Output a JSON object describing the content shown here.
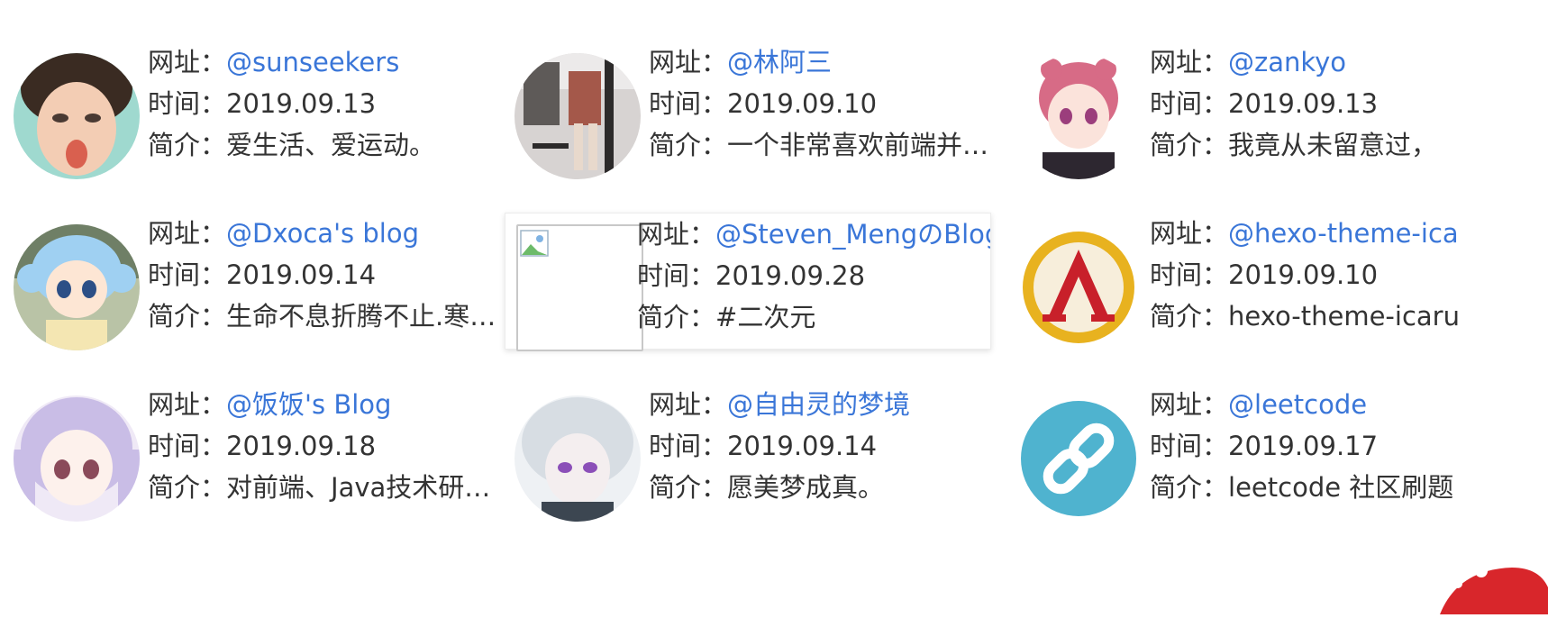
{
  "labels": {
    "url": "网址：",
    "time": "时间：",
    "intro": "简介："
  },
  "links": [
    {
      "name": "@sunseekers",
      "time": "2019.09.13",
      "intro": "爱生活、爱运动。"
    },
    {
      "name": "@林阿三",
      "time": "2019.09.10",
      "intro": "一个非常喜欢前端并…"
    },
    {
      "name": "@zankyo",
      "time": "2019.09.13",
      "intro": "我竟从未留意过，"
    },
    {
      "name": "@Dxoca's blog",
      "time": "2019.09.14",
      "intro": "生命不息折腾不止.寒…"
    },
    {
      "name": "@Steven_MengのBlog",
      "time": "2019.09.28",
      "intro": "#二次元"
    },
    {
      "name": "@hexo-theme-ica",
      "time": "2019.09.10",
      "intro": "hexo-theme-icaru"
    },
    {
      "name": "@饭饭's Blog",
      "time": "2019.09.18",
      "intro": "对前端、Java技术研…"
    },
    {
      "name": "@自由灵的梦境",
      "time": "2019.09.14",
      "intro": "愿美梦成真。"
    },
    {
      "name": "@leetcode",
      "time": "2019.09.17",
      "intro": "leetcode 社区刷题"
    }
  ],
  "colors": {
    "link": "#3a76d8",
    "text": "#333333",
    "leetcode_bg": "#4fb3cf",
    "icarus_ring": "#e8b21f",
    "icarus_symbol": "#c8202a"
  },
  "icons": [
    "avatar-sunseekers",
    "avatar-linasan",
    "avatar-zankyo",
    "avatar-dxoca",
    "broken-image-icon",
    "icarus-logo",
    "avatar-fanfan",
    "avatar-ziyouling",
    "link-chain-icon",
    "santa-hat-decoration"
  ]
}
